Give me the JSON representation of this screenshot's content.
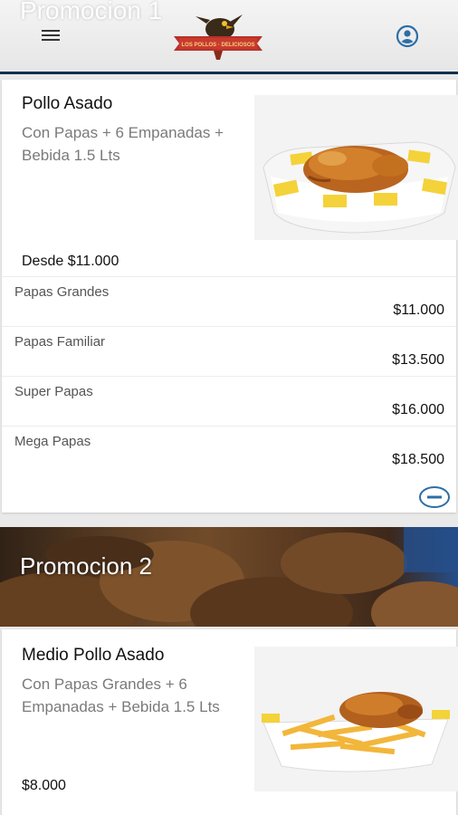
{
  "header": {
    "section_title": "Promocion 1",
    "menu_icon": "hamburger-menu-icon",
    "logo_icon": "restaurant-logo-icon",
    "profile_icon": "user-account-icon"
  },
  "product_1": {
    "title": "Pollo Asado",
    "description": "Con Papas + 6 Empanadas + Bebida 1.5 Lts",
    "price_from": "Desde $11.000",
    "image_icon": "roast-chicken-basket-image",
    "options": [
      {
        "name": "Papas Grandes",
        "price": "$11.000"
      },
      {
        "name": "Papas Familiar",
        "price": "$13.500"
      },
      {
        "name": "Super Papas",
        "price": "$16.000"
      },
      {
        "name": "Mega Papas",
        "price": "$18.500"
      }
    ],
    "collapse_icon": "minus-circle-icon"
  },
  "promo_2": {
    "title": "Promocion 2",
    "banner_icon": "empanadas-banner-image"
  },
  "product_2": {
    "title": "Medio Pollo Asado",
    "description": "Con Papas Grandes + 6 Empanadas + Bebida 1.5 Lts",
    "price_from": "$8.000",
    "image_icon": "half-chicken-fries-tray-image"
  },
  "colors": {
    "accent": "#2c6ea6",
    "header_border": "#0f2f4d"
  }
}
